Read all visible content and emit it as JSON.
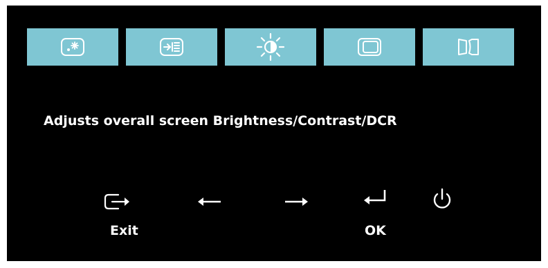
{
  "menu_tabs": [
    {
      "icon": "display-settings-icon"
    },
    {
      "icon": "input-signal-icon"
    },
    {
      "icon": "brightness-contrast-icon"
    },
    {
      "icon": "image-position-icon"
    },
    {
      "icon": "image-setup-icon"
    }
  ],
  "selected_tab": 2,
  "description": "Adjusts overall screen Brightness/Contrast/DCR",
  "buttons": {
    "exit": {
      "label": "Exit",
      "icon": "exit-icon"
    },
    "left": {
      "icon": "arrow-left-icon"
    },
    "right": {
      "icon": "arrow-right-icon"
    },
    "ok": {
      "label": "OK",
      "icon": "enter-icon"
    },
    "power": {
      "icon": "power-icon"
    }
  },
  "colors": {
    "panel_background": "#000000",
    "tab_background": "#7fc6d3",
    "icon_color": "#ffffff",
    "text_color": "#ffffff"
  }
}
